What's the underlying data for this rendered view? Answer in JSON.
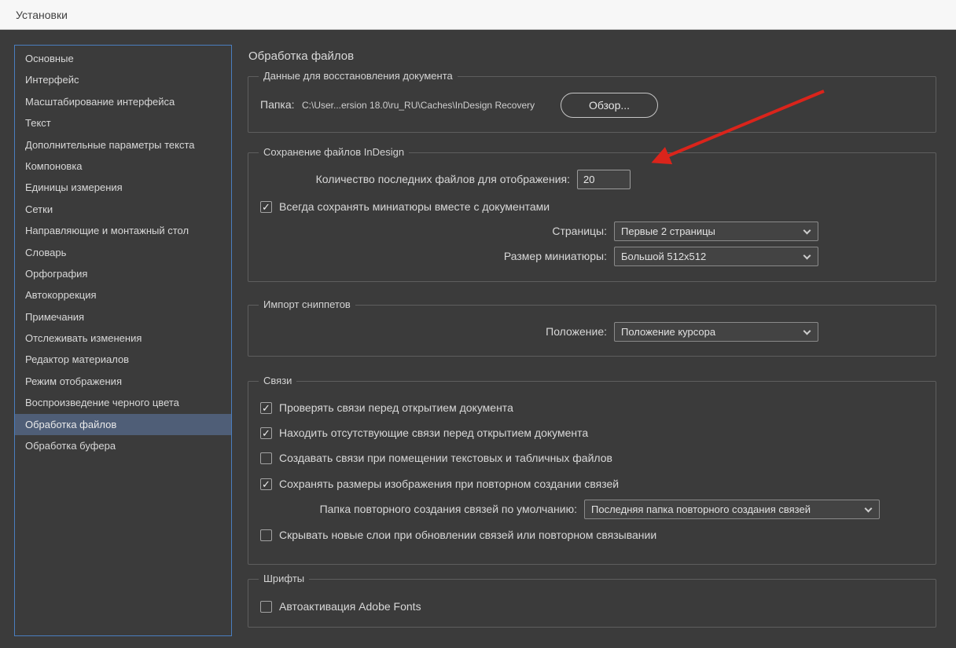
{
  "icons": {
    "checkmark": "✓"
  },
  "colors": {
    "accent_blue": "#4a7ebf",
    "selection_blue": "#4f5e77",
    "arrow_red": "#da241b"
  },
  "titlebar": {
    "title": "Установки"
  },
  "sidebar": {
    "items": [
      {
        "label": "Основные",
        "selected": false
      },
      {
        "label": "Интерфейс",
        "selected": false
      },
      {
        "label": "Масштабирование интерфейса",
        "selected": false
      },
      {
        "label": "Текст",
        "selected": false
      },
      {
        "label": "Дополнительные параметры текста",
        "selected": false
      },
      {
        "label": "Компоновка",
        "selected": false
      },
      {
        "label": "Единицы измерения",
        "selected": false
      },
      {
        "label": "Сетки",
        "selected": false
      },
      {
        "label": "Направляющие и монтажный стол",
        "selected": false
      },
      {
        "label": "Словарь",
        "selected": false
      },
      {
        "label": "Орфография",
        "selected": false
      },
      {
        "label": "Автокоррекция",
        "selected": false
      },
      {
        "label": "Примечания",
        "selected": false
      },
      {
        "label": "Отслеживать изменения",
        "selected": false
      },
      {
        "label": "Редактор материалов",
        "selected": false
      },
      {
        "label": "Режим отображения",
        "selected": false
      },
      {
        "label": "Воспроизведение черного цвета",
        "selected": false
      },
      {
        "label": "Обработка файлов",
        "selected": true
      },
      {
        "label": "Обработка буфера",
        "selected": false
      }
    ]
  },
  "main": {
    "heading": "Обработка файлов",
    "recovery": {
      "title": "Данные для восстановления документа",
      "folder_label": "Папка:",
      "folder_path": "C:\\User...ersion 18.0\\ru_RU\\Caches\\InDesign Recovery",
      "browse_button": "Обзор..."
    },
    "saving": {
      "title": "Сохранение файлов InDesign",
      "recent_label": "Количество последних файлов для отображения:",
      "recent_value": "20",
      "thumbs_label": "Всегда сохранять миниатюры вместе с документами",
      "thumbs_checked": true,
      "pages_label": "Страницы:",
      "pages_value": "Первые 2 страницы",
      "size_label": "Размер миниатюры:",
      "size_value": "Большой 512x512"
    },
    "snippets": {
      "title": "Импорт сниппетов",
      "position_label": "Положение:",
      "position_value": "Положение курсора"
    },
    "links": {
      "title": "Связи",
      "checkboxes": [
        {
          "label": "Проверять связи перед открытием документа",
          "checked": true
        },
        {
          "label": "Находить отсутствующие связи перед открытием документа",
          "checked": true
        },
        {
          "label": "Создавать связи при помещении текстовых и табличных файлов",
          "checked": false
        },
        {
          "label": "Сохранять размеры изображения при повторном создании связей",
          "checked": true
        }
      ],
      "relink_label": "Папка повторного создания связей по умолчанию:",
      "relink_value": "Последняя папка повторного создания связей",
      "hide_layers_label": "Скрывать новые слои при обновлении связей или повторном связывании",
      "hide_layers_checked": false
    },
    "fonts": {
      "title": "Шрифты",
      "auto_label": "Автоактивация Adobe Fonts",
      "auto_checked": false
    }
  }
}
